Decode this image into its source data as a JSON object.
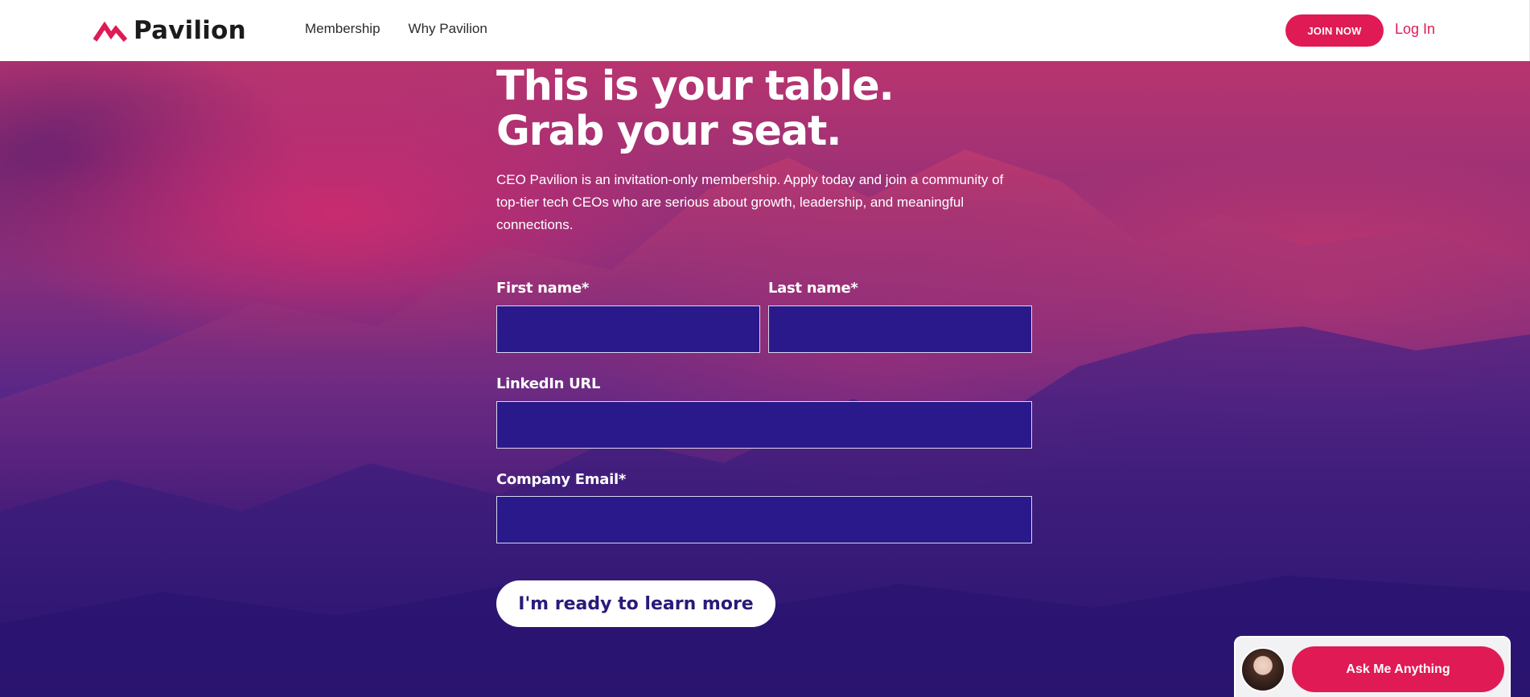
{
  "header": {
    "brand": "Pavilion",
    "nav": [
      "Membership",
      "Why Pavilion"
    ],
    "join_label": "JOIN NOW",
    "login_label": "Log In"
  },
  "hero": {
    "title": "This is your table. Grab your seat.",
    "description": "CEO Pavilion is an invitation-only membership. Apply today and join a community of top-tier tech CEOs who are serious about growth, leadership, and meaningful connections."
  },
  "form": {
    "first_name_label": "First name*",
    "first_name_value": "",
    "last_name_label": "Last name*",
    "last_name_value": "",
    "linkedin_label": "LinkedIn URL",
    "linkedin_value": "",
    "email_label": "Company Email*",
    "email_value": "",
    "submit_label": "I'm ready to learn more"
  },
  "chat": {
    "button_label": "Ask Me Anything"
  },
  "colors": {
    "accent": "#e01a54",
    "field_bg": "#29198a",
    "hero_dark": "#2a1470"
  }
}
